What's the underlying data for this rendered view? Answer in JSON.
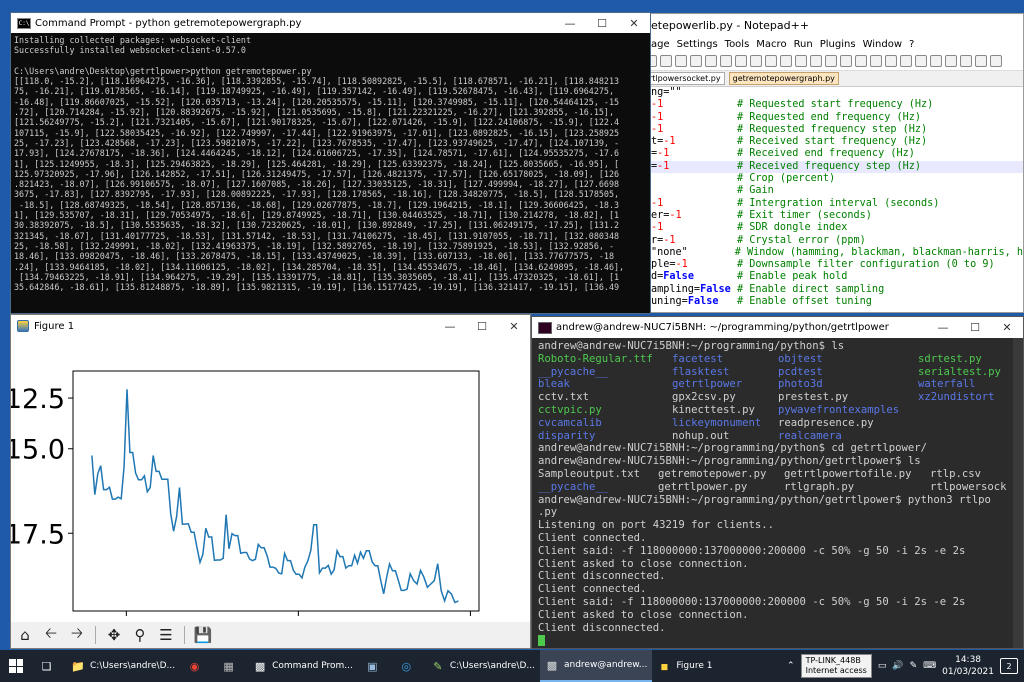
{
  "notepad": {
    "title": "etepowerlib.py - Notepad++",
    "menu": [
      "age",
      "Settings",
      "Tools",
      "Macro",
      "Run",
      "Plugins",
      "Window",
      "?"
    ],
    "tabs": [
      "rtlpowersocket.py",
      "getremotepowergraph.py"
    ],
    "code": [
      {
        "left": "ng=\"\"",
        "comment": ""
      },
      {
        "left": "-1",
        "comment": "# Requested start frequency (Hz)"
      },
      {
        "left": "-1",
        "comment": "# Requested end frequency (Hz)"
      },
      {
        "left": "-1",
        "comment": "# Requested frequency step (Hz)"
      },
      {
        "left": "t=-1",
        "comment": "# Received start frequency (Hz)"
      },
      {
        "left": "=-1",
        "comment": "# Received end frequency (Hz)"
      },
      {
        "left": "=-1",
        "comment": "# Received frequency step (Hz)"
      },
      {
        "left": "",
        "comment": "# Crop (percent)"
      },
      {
        "left": "",
        "comment": "# Gain"
      },
      {
        "left": "-1",
        "comment": "# Intergration interval (seconds)"
      },
      {
        "left": "er=-1",
        "comment": "# Exit timer (seconds)"
      },
      {
        "left": "-1",
        "comment": "# SDR dongle index"
      },
      {
        "left": "r=-1",
        "comment": "# Crystal error (ppm)"
      },
      {
        "left": "\"none\"",
        "comment": "# Window (hamming, blackman, blackman-harris, h"
      },
      {
        "left": "ple=-1",
        "comment": "# Downsample filter configuration (0 to 9)"
      },
      {
        "left": "d=False",
        "comment": "# Enable peak hold"
      },
      {
        "left": "ampling=False",
        "comment": "# Enable direct sampling"
      },
      {
        "left": "uning=False",
        "comment": "# Enable offset tuning"
      }
    ]
  },
  "cmd": {
    "title": "Command Prompt - python  getremotepowergraph.py",
    "lines": [
      "Installing collected packages: websocket-client",
      "Successfully installed websocket-client-0.57.0",
      "",
      "C:\\Users\\andre\\Desktop\\getrtlpower>python getremotepower.py",
      "[[118.0, -15.2], [118.16964275, -16.36], [118.3392855, -15.74], [118.50892825, -15.5], [118.678571, -16.21], [118.848213",
      "75, -16.21], [119.0178565, -16.14], [119.18749925, -16.49], [119.357142, -16.49], [119.52678475, -16.43], [119.6964275,",
      "-16.48], [119.86607025, -15.52], [120.035713, -13.24], [120.20535575, -15.11], [120.3749985, -15.11], [120.54464125, -15",
      ".72], [120.714284, -15.92], [120.88392675, -15.92], [121.0535695, -15.8], [121.22321225, -16.27], [121.392855, -16.15],",
      "[121.56249775, -15.2], [121.7321405, -15.67], [121.90178325, -15.67], [122.071426, -15.9], [122.24106875, -15.9], [122.4",
      "107115, -15.9], [122.58035425, -16.92], [122.749997, -17.44], [122.91963975, -17.01], [123.0892825, -16.15], [123.258925",
      "25, -17.23], [123.428568, -17.23], [123.59821075, -17.22], [123.7678535, -17.47], [123.93749625, -17.47], [124.107139, -",
      "17.93], [124.27678175, -18.36], [124.4464245, -18.12], [124.61606725, -17.35], [124.78571, -17.61], [124.95535275, -17.6",
      "1], [125.1249955, -18.3], [125.29463825, -18.29], [125.464281, -18.29], [125.63392375, -18.24], [125.8035665, -16.95], [",
      "125.97320925, -17.96], [126.142852, -17.51], [126.31249475, -17.57], [126.4821375, -17.57], [126.65178025, -18.09], [126",
      ".821423, -18.07], [126.99106575, -18.07], [127.1607085, -18.26], [127.33035125, -18.31], [127.499994, -18.27], [127.6698",
      "3675, -17.83], [127.8392795, -17.93], [128.00892225, -17.93], [128.178565, -18.16], [128.34820775, -18.5], [128.5178505,",
      " -18.5], [128.68749325, -18.54], [128.857136, -18.68], [129.02677875, -18.7], [129.1964215, -18.1], [129.36606425, -18.3",
      "1], [129.535707, -18.31], [129.70534975, -18.6], [129.8749925, -18.71], [130.04463525, -18.71], [130.214278, -18.82], [1",
      "30.38392075, -18.5], [130.5535635, -18.32], [130.72320625, -18.01], [130.892849, -17.25], [131.06249175, -17.25], [131.2",
      "321345, -18.67], [131.40177725, -18.53], [131.57142, -18.53], [131.74106275, -18.45], [131.9107055, -18.71], [132.080348",
      "25, -18.58], [132.249991, -18.02], [132.41963375, -18.19], [132.5892765, -18.19], [132.75891925, -18.53], [132.92856, -",
      "18.46], [133.09820475, -18.46], [133.2678475, -18.15], [133.43749025, -18.39], [133.607133, -18.06], [133.77677575, -18",
      ".24], [133.9464185, -18.02], [134.11606125, -18.02], [134.285704, -18.35], [134.45534675, -18.46], [134.6249895, -18.46],",
      " [134.79463225, -18.91], [134.964275, -19.29], [135.13391775, -18.81], [135.3035605, -18.41], [135.47320325, -18.61], [1",
      "35.642846, -18.61], [135.81248875, -18.89], [135.9821315, -19.19], [136.15177425, -19.19], [136.321417, -19.15], [136.49"
    ]
  },
  "figure": {
    "title": "Figure 1",
    "toolbar": [
      "home-icon",
      "back-icon",
      "forward-icon",
      "pan-icon",
      "zoom-icon",
      "configure-icon",
      "save-icon"
    ]
  },
  "chart_data": {
    "type": "line",
    "title": "",
    "xlabel": "",
    "ylabel": "",
    "xlim": [
      116.9,
      140.5
    ],
    "ylim": [
      -19.8,
      -12.7
    ],
    "x_ticks": [
      120,
      130,
      140
    ],
    "y_ticks": [
      -13.5,
      -15.0,
      -17.5
    ],
    "y_tick_labels": [
      "12.5",
      "15.0",
      "17.5"
    ],
    "grid": false,
    "color": "#1f77b4",
    "series": [
      {
        "name": "",
        "x": [
          118.0,
          118.17,
          118.34,
          118.51,
          118.68,
          118.85,
          119.02,
          119.19,
          119.36,
          119.53,
          119.7,
          119.87,
          120.04,
          120.21,
          120.37,
          120.54,
          120.71,
          120.88,
          121.05,
          121.22,
          121.39,
          121.56,
          121.73,
          121.9,
          122.07,
          122.24,
          122.41,
          122.58,
          122.75,
          122.92,
          123.09,
          123.26,
          123.43,
          123.6,
          123.77,
          123.94,
          124.11,
          124.28,
          124.45,
          124.62,
          124.79,
          124.96,
          125.12,
          125.29,
          125.46,
          125.63,
          125.8,
          125.97,
          126.14,
          126.31,
          126.48,
          126.65,
          126.82,
          126.99,
          127.16,
          127.33,
          127.5,
          127.67,
          127.84,
          128.01,
          128.18,
          128.35,
          128.52,
          128.69,
          128.86,
          129.03,
          129.2,
          129.37,
          129.54,
          129.71,
          129.87,
          130.04,
          130.21,
          130.38,
          130.55,
          130.72,
          130.89,
          131.06,
          131.23,
          131.4,
          131.57,
          131.74,
          131.91,
          132.08,
          132.25,
          132.42,
          132.59,
          132.76,
          132.93,
          133.1,
          133.27,
          133.44,
          133.61,
          133.78,
          133.95,
          134.12,
          134.29,
          134.46,
          134.62,
          134.79,
          134.96,
          135.13,
          135.3,
          135.47,
          135.64,
          135.81,
          135.98,
          136.15,
          136.32,
          136.5,
          136.7,
          136.9,
          137.1,
          137.3,
          137.5,
          137.7,
          137.9,
          138.1,
          138.3,
          138.5,
          138.7,
          138.9,
          139.1,
          139.3
        ],
        "y": [
          -15.2,
          -16.36,
          -15.74,
          -15.5,
          -16.21,
          -16.21,
          -16.14,
          -16.49,
          -16.49,
          -16.43,
          -16.48,
          -15.52,
          -13.24,
          -15.11,
          -15.11,
          -15.72,
          -15.92,
          -15.92,
          -15.8,
          -16.27,
          -16.15,
          -15.2,
          -15.67,
          -15.67,
          -15.9,
          -15.9,
          -15.9,
          -16.92,
          -17.44,
          -17.01,
          -16.15,
          -17.23,
          -17.23,
          -17.22,
          -17.47,
          -17.47,
          -17.93,
          -18.36,
          -18.12,
          -17.35,
          -17.61,
          -17.61,
          -18.3,
          -18.29,
          -18.29,
          -18.24,
          -16.95,
          -17.96,
          -17.51,
          -17.57,
          -17.57,
          -18.09,
          -18.07,
          -18.07,
          -18.26,
          -18.31,
          -18.27,
          -17.83,
          -17.93,
          -17.93,
          -18.16,
          -18.5,
          -18.5,
          -18.54,
          -18.68,
          -18.7,
          -18.1,
          -18.31,
          -18.31,
          -18.6,
          -18.71,
          -18.71,
          -18.82,
          -18.5,
          -18.32,
          -18.01,
          -17.25,
          -17.25,
          -18.67,
          -18.53,
          -18.53,
          -18.45,
          -18.71,
          -18.58,
          -18.02,
          -18.19,
          -18.19,
          -18.53,
          -18.46,
          -18.46,
          -18.15,
          -18.39,
          -18.06,
          -18.24,
          -18.02,
          -18.02,
          -18.35,
          -18.46,
          -18.46,
          -18.91,
          -19.29,
          -18.81,
          -18.41,
          -18.61,
          -18.61,
          -18.89,
          -19.19,
          -19.19,
          -19.15,
          -18.7,
          -18.9,
          -19.0,
          -18.6,
          -18.8,
          -19.1,
          -19.0,
          -18.9,
          -18.4,
          -19.2,
          -19.5,
          -19.2,
          -19.3,
          -19.55,
          -19.5
        ]
      }
    ]
  },
  "terminal": {
    "title": "andrew@andrew-NUC7i5BNH: ~/programming/python/getrtlpower",
    "lines": [
      {
        "type": "text",
        "text": "andrew@andrew-NUC7i5BNH:~/programming/python$ ls"
      },
      {
        "type": "ls",
        "cols": [
          [
            {
              "t": "Roboto-Regular.ttf",
              "c": "exe"
            },
            {
              "t": "facetest",
              "c": "dir"
            },
            {
              "t": "objtest",
              "c": "dir"
            },
            {
              "t": "sdrtest.py",
              "c": "exe"
            }
          ],
          [
            {
              "t": "__pycache__",
              "c": "dir"
            },
            {
              "t": "flasktest",
              "c": "dir"
            },
            {
              "t": "pcdtest",
              "c": "dir"
            },
            {
              "t": "serialtest.py",
              "c": "exe"
            }
          ],
          [
            {
              "t": "bleak",
              "c": "dir"
            },
            {
              "t": "getrtlpower",
              "c": "dir"
            },
            {
              "t": "photo3d",
              "c": "dir"
            },
            {
              "t": "waterfall",
              "c": "dir"
            }
          ],
          [
            {
              "t": "cctv.txt",
              "c": "file"
            },
            {
              "t": "gpx2csv.py",
              "c": "file"
            },
            {
              "t": "prestest.py",
              "c": "file"
            },
            {
              "t": "xz2undistort",
              "c": "dir"
            }
          ],
          [
            {
              "t": "cctvpic.py",
              "c": "exe"
            },
            {
              "t": "kinecttest.py",
              "c": "file"
            },
            {
              "t": "pywavefrontexamples",
              "c": "dir"
            },
            {
              "t": "",
              "c": "file"
            }
          ],
          [
            {
              "t": "cvcamcalib",
              "c": "dir"
            },
            {
              "t": "lickeymonument",
              "c": "dir"
            },
            {
              "t": "readpresence.py",
              "c": "file"
            },
            {
              "t": "",
              "c": "file"
            }
          ],
          [
            {
              "t": "disparity",
              "c": "dir"
            },
            {
              "t": "nohup.out",
              "c": "file"
            },
            {
              "t": "realcamera",
              "c": "dir"
            },
            {
              "t": "",
              "c": "file"
            }
          ]
        ]
      },
      {
        "type": "text",
        "text": "andrew@andrew-NUC7i5BNH:~/programming/python$ cd getrtlpower/"
      },
      {
        "type": "text",
        "text": "andrew@andrew-NUC7i5BNH:~/programming/python/getrtlpower$ ls"
      },
      {
        "type": "ls2",
        "cols": [
          [
            {
              "t": "Sampleoutput.txt",
              "c": "file"
            },
            {
              "t": "getremotepower.py",
              "c": "file"
            },
            {
              "t": "getrtlpowertofile.py",
              "c": "file"
            },
            {
              "t": "rtlp.csv",
              "c": "file"
            }
          ],
          [
            {
              "t": "__pycache__",
              "c": "dir"
            },
            {
              "t": "getrtlpower.py",
              "c": "file"
            },
            {
              "t": "rtlgraph.py",
              "c": "file"
            },
            {
              "t": "rtlpowersock",
              "c": "file"
            }
          ]
        ]
      },
      {
        "type": "text",
        "text": "andrew@andrew-NUC7i5BNH:~/programming/python/getrtlpower$ python3 rtlpo"
      },
      {
        "type": "text",
        "text": ".py"
      },
      {
        "type": "text",
        "text": "Listening on port 43219 for clients.."
      },
      {
        "type": "text",
        "text": "Client connected."
      },
      {
        "type": "text",
        "text": "Client said: -f 118000000:137000000:200000 -c 50% -g 50 -i 2s -e 2s"
      },
      {
        "type": "text",
        "text": "Client asked to close connection."
      },
      {
        "type": "text",
        "text": "Client disconnected."
      },
      {
        "type": "text",
        "text": "Client connected."
      },
      {
        "type": "text",
        "text": "Client said: -f 118000000:137000000:200000 -c 50% -g 50 -i 2s -e 2s"
      },
      {
        "type": "text",
        "text": "Client asked to close connection."
      },
      {
        "type": "text",
        "text": "Client disconnected."
      },
      {
        "type": "cursor",
        "text": ""
      }
    ]
  },
  "taskbar": {
    "items": [
      {
        "label": "C:\\Users\\andre\\D...",
        "icon": "folder-icon",
        "active": false
      },
      {
        "label": "",
        "icon": "chrome-icon",
        "active": false
      },
      {
        "label": "",
        "icon": "calculator-icon",
        "active": false
      },
      {
        "label": "Command Prom...",
        "icon": "cmd-icon",
        "active": false
      },
      {
        "label": "",
        "icon": "network-icon",
        "active": false
      },
      {
        "label": "",
        "icon": "edge-icon",
        "active": false
      },
      {
        "label": "C:\\Users\\andre\\D...",
        "icon": "notepadpp-icon",
        "active": false
      },
      {
        "label": "andrew@andrew...",
        "icon": "terminal-icon",
        "active": true
      },
      {
        "label": "Figure 1",
        "icon": "figure-icon",
        "active": false
      }
    ],
    "wifi_name": "TP-LINK_448B",
    "wifi_status": "Internet access",
    "time": "14:38",
    "date": "01/03/2021",
    "notifications": "2"
  }
}
